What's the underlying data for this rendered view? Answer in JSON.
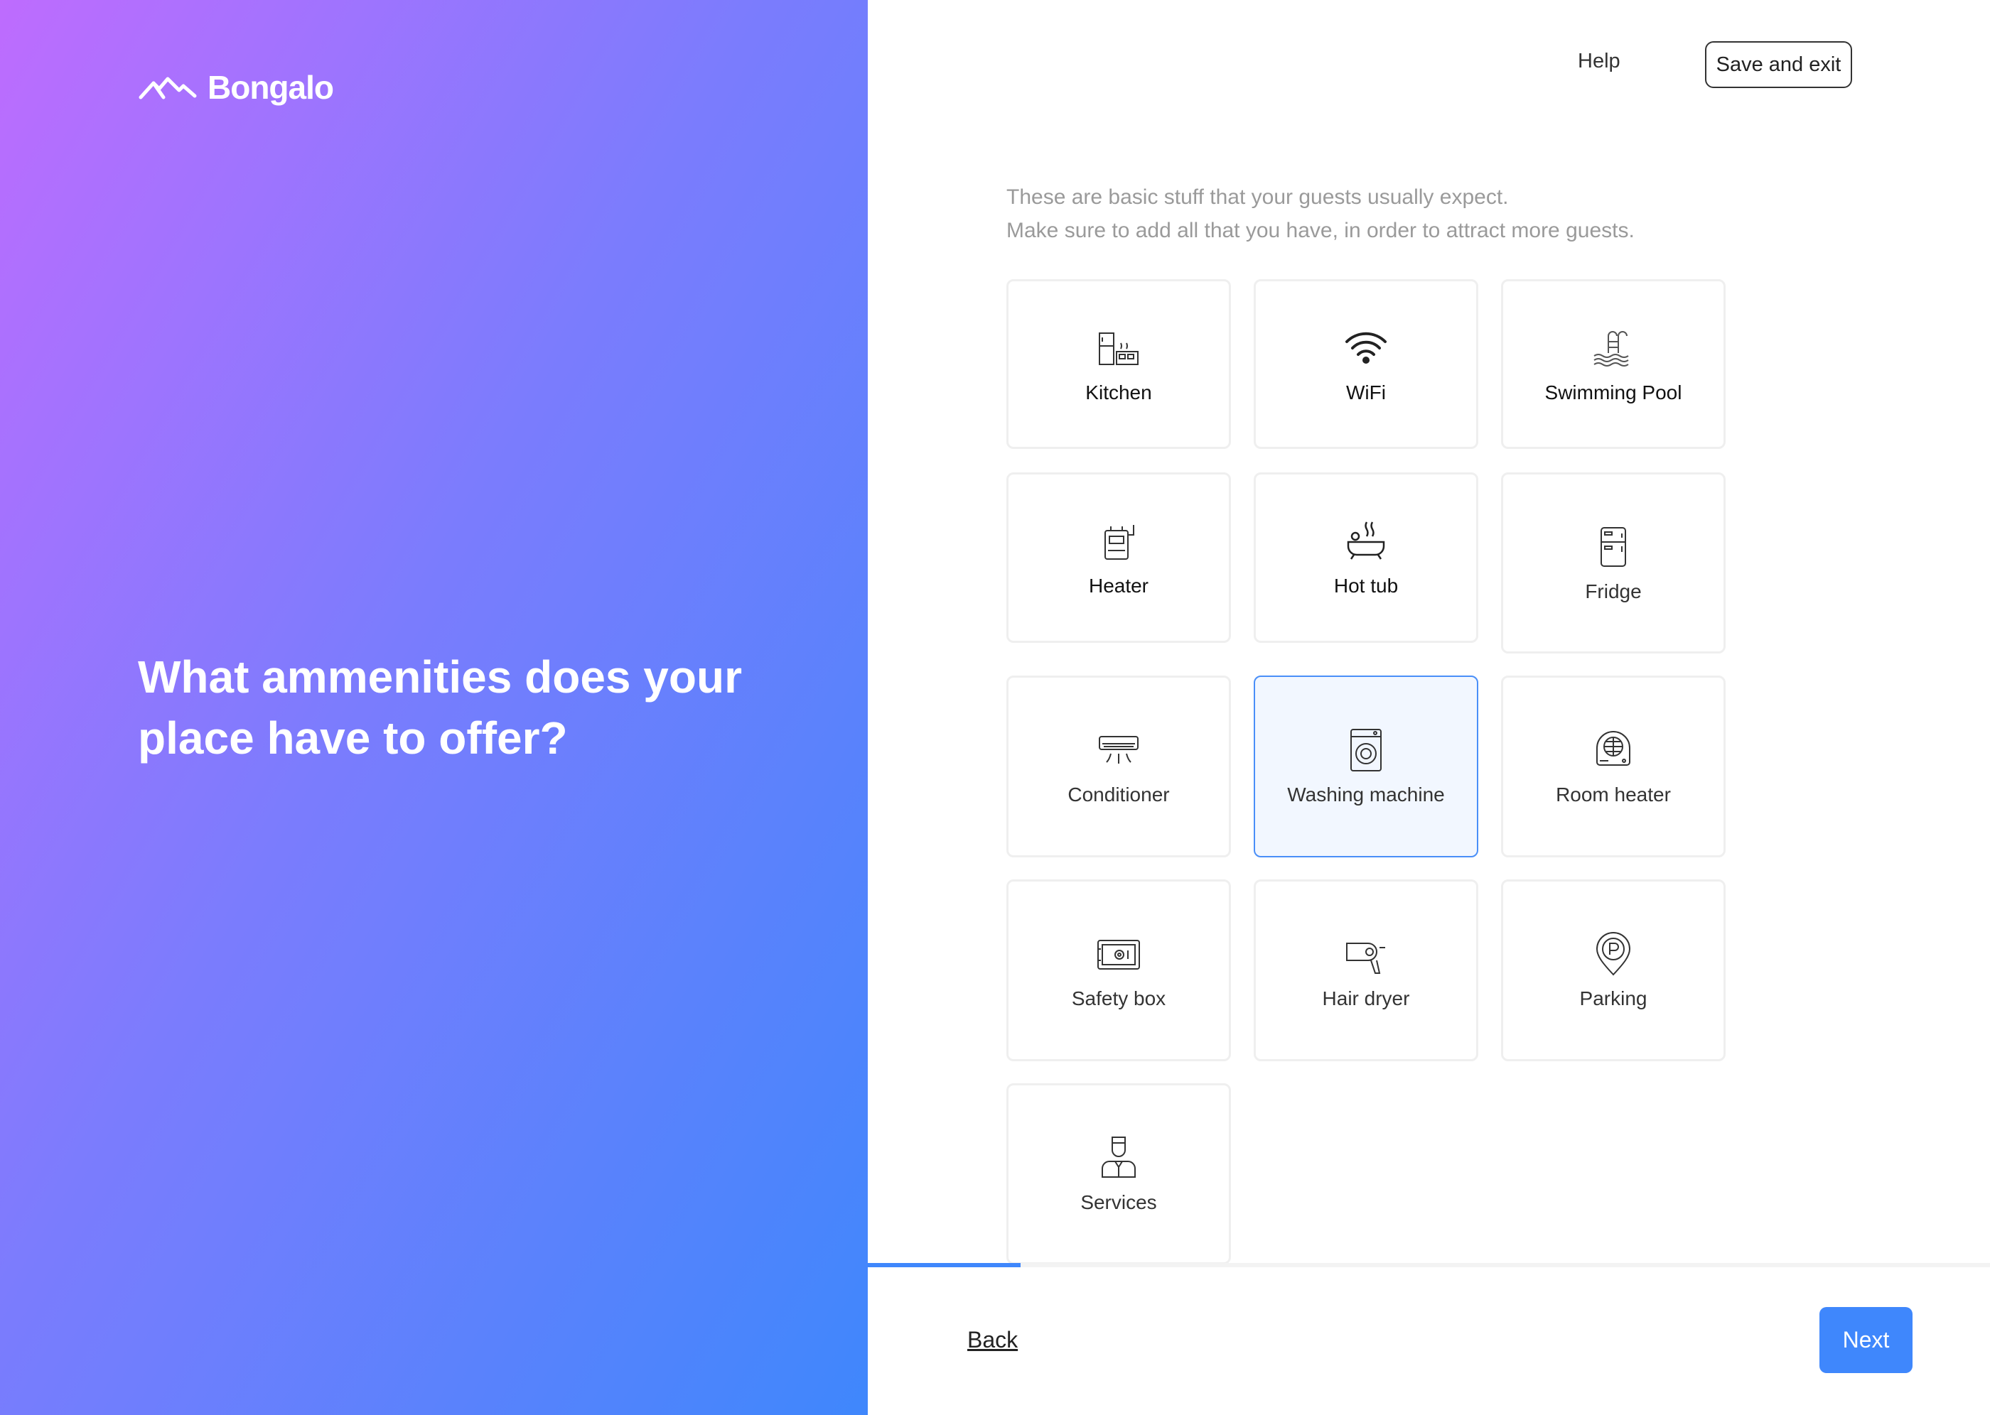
{
  "brand": {
    "name": "Bongalo"
  },
  "left": {
    "headline": "What ammenities does your place have to offer?"
  },
  "header": {
    "help_label": "Help",
    "save_exit_label": "Save and exit"
  },
  "intro": {
    "line1": "These are basic stuff that your guests usually expect.",
    "line2": "Make sure to add all that you have, in order to attract more guests."
  },
  "amenities": [
    {
      "label": "Kitchen",
      "icon": "kitchen-icon",
      "selected": false
    },
    {
      "label": "WiFi",
      "icon": "wifi-icon",
      "selected": false
    },
    {
      "label": "Swimming Pool",
      "icon": "swimming-pool-icon",
      "selected": false
    },
    {
      "label": "Heater",
      "icon": "heater-icon",
      "selected": false
    },
    {
      "label": "Hot tub",
      "icon": "hot-tub-icon",
      "selected": false
    },
    {
      "label": "Fridge",
      "icon": "fridge-icon",
      "selected": false
    },
    {
      "label": "Conditioner",
      "icon": "air-conditioner-icon",
      "selected": false
    },
    {
      "label": "Washing machine",
      "icon": "washing-machine-icon",
      "selected": true
    },
    {
      "label": "Room heater",
      "icon": "room-heater-icon",
      "selected": false
    },
    {
      "label": "Safety box",
      "icon": "safety-box-icon",
      "selected": false
    },
    {
      "label": "Hair dryer",
      "icon": "hair-dryer-icon",
      "selected": false
    },
    {
      "label": "Parking",
      "icon": "parking-icon",
      "selected": false
    },
    {
      "label": "Services",
      "icon": "services-icon",
      "selected": false
    }
  ],
  "footer": {
    "back_label": "Back",
    "next_label": "Next",
    "progress": 0.136
  },
  "colors": {
    "accent": "#3f87fc",
    "gradient_start": "#be6cfe",
    "gradient_end": "#3f87fc",
    "selected_bg": "#f2f7ff"
  }
}
